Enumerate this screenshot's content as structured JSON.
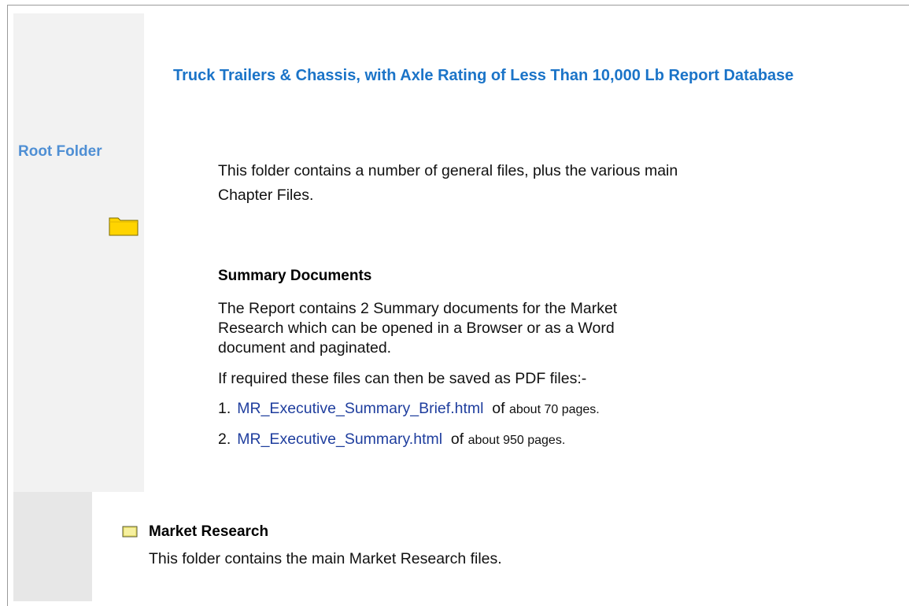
{
  "sidebar": {
    "root_label": "Root Folder"
  },
  "icons": {
    "root_folder": "folder-icon",
    "market_research_folder": "folder-icon"
  },
  "colors": {
    "title_blue": "#1b74c8",
    "root_label_blue": "#4f8fd4",
    "link_blue": "#1f3e9e",
    "folder_yellow": "#ffd400"
  },
  "main": {
    "title": "Truck Trailers & Chassis, with Axle Rating of Less Than 10,000 Lb Report Database",
    "description": "This folder contains a number of general files, plus the various main Chapter Files.",
    "summary": {
      "heading": "Summary Documents",
      "text": "The Report contains 2 Summary documents for the Market Research which can be opened in a Browser or as a Word document and paginated.",
      "pdf_note": "If required these files can then be saved as PDF files:-",
      "files": [
        {
          "number": "1.",
          "name": "MR_Executive_Summary_Brief.html",
          "of": "of",
          "pages": "about 70 pages."
        },
        {
          "number": "2.",
          "name": "MR_Executive_Summary.html",
          "of": "of",
          "pages": "about 950 pages."
        }
      ]
    },
    "market_research": {
      "heading": "Market Research",
      "description": "This folder contains the main Market Research files."
    }
  }
}
